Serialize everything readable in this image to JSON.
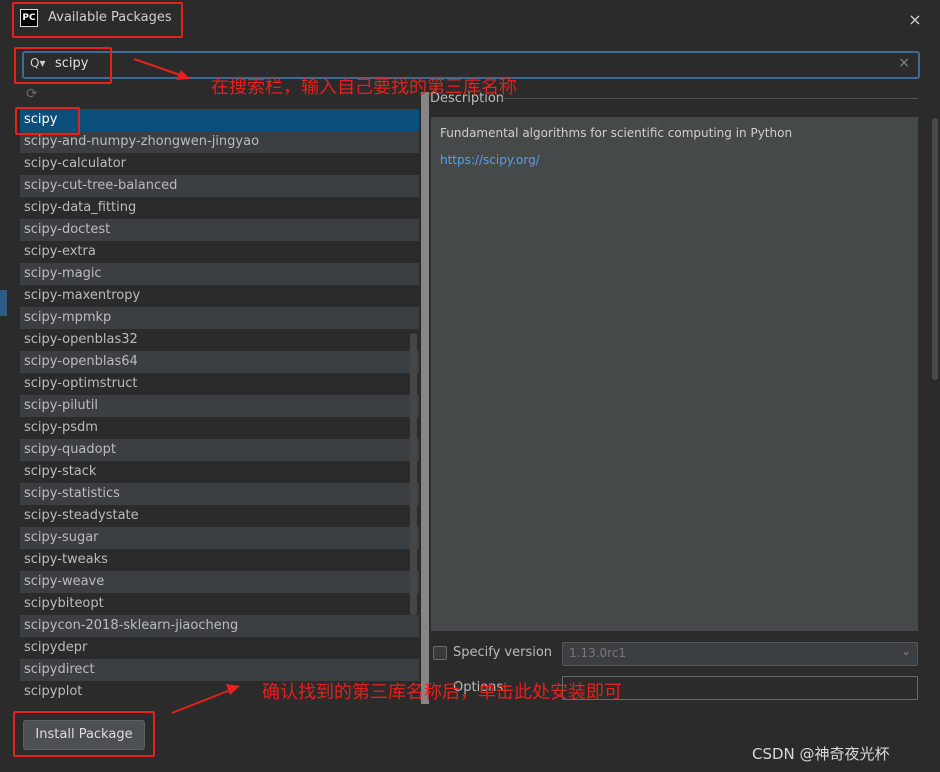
{
  "window": {
    "logo": "PC",
    "title": "Available Packages",
    "close_icon": "×"
  },
  "search": {
    "icon": "Q▾",
    "value": "scipy",
    "clear_icon": "×"
  },
  "refresh_icon": "⟳",
  "packages": [
    "scipy",
    "scipy-and-numpy-zhongwen-jingyao",
    "scipy-calculator",
    "scipy-cut-tree-balanced",
    "scipy-data_fitting",
    "scipy-doctest",
    "scipy-extra",
    "scipy-magic",
    "scipy-maxentropy",
    "scipy-mpmkp",
    "scipy-openblas32",
    "scipy-openblas64",
    "scipy-optimstruct",
    "scipy-pilutil",
    "scipy-psdm",
    "scipy-quadopt",
    "scipy-stack",
    "scipy-statistics",
    "scipy-steadystate",
    "scipy-sugar",
    "scipy-tweaks",
    "scipy-weave",
    "scipybiteopt",
    "scipycon-2018-sklearn-jiaocheng",
    "scipydepr",
    "scipydirect",
    "scipyplot"
  ],
  "selected_package": "scipy",
  "description": {
    "label": "Description",
    "text": "Fundamental algorithms for scientific computing in Python",
    "link": "https://scipy.org/"
  },
  "specify_version": {
    "label": "Specify version",
    "checked": false,
    "value": "1.13.0rc1",
    "chevron_icon": "⌄"
  },
  "options": {
    "label": "Options",
    "value": ""
  },
  "install_button": "Install Package",
  "annotations": {
    "search_note": "在搜索栏，输入自己要找的第三库名称",
    "install_note": "确认找到的第三库名称后，单击此处安装即可",
    "color": "#e5201d"
  },
  "watermark": "CSDN @神奇夜光杯"
}
